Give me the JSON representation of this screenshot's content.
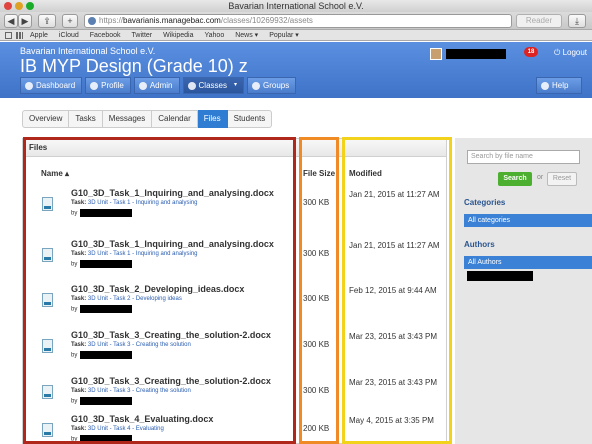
{
  "browser": {
    "window_title": "Bavarian International School e.V.",
    "url_scheme": "https://",
    "url_host": "bavarianis.managebac.com",
    "url_path": "/classes/10269932/assets",
    "reader_label": "Reader",
    "add_tab": "+",
    "bookmarks": [
      "Apple",
      "iCloud",
      "Facebook",
      "Twitter",
      "Wikipedia",
      "Yahoo",
      "News ▾",
      "Popular ▾"
    ]
  },
  "header": {
    "school": "Bavarian International School e.V.",
    "class_title": "IB MYP Design (Grade 10) z",
    "notifications": "18",
    "logout": "Logout"
  },
  "nav": {
    "items": [
      "Dashboard",
      "Profile",
      "Admin",
      "Classes",
      "Groups"
    ],
    "help": "Help"
  },
  "tabs": [
    "Overview",
    "Tasks",
    "Messages",
    "Calendar",
    "Files",
    "Students"
  ],
  "active_tab": "Files",
  "files": {
    "section_title": "Files",
    "col_name": "Name ▴",
    "col_size": "File Size",
    "col_modified": "Modified",
    "task_label": "Task:",
    "by_label": "by",
    "rows": [
      {
        "name": "G10_3D_Task_1_Inquiring_and_analysing.docx",
        "task": "3D Unit - Task 1 - Inquiring and analysing",
        "size": "300 KB",
        "modified": "Jan 21, 2015 at 11:27 AM"
      },
      {
        "name": "G10_3D_Task_1_Inquiring_and_analysing.docx",
        "task": "3D Unit - Task 1 - Inquiring and analysing",
        "size": "300 KB",
        "modified": "Jan 21, 2015 at 11:27 AM"
      },
      {
        "name": "G10_3D_Task_2_Developing_ideas.docx",
        "task": "3D Unit - Task 2 - Developing ideas",
        "size": "300 KB",
        "modified": "Feb 12, 2015 at 9:44 AM"
      },
      {
        "name": "G10_3D_Task_3_Creating_the_solution-2.docx",
        "task": "3D Unit - Task 3 - Creating the solution",
        "size": "300 KB",
        "modified": "Mar 23, 2015 at 3:43 PM"
      },
      {
        "name": "G10_3D_Task_3_Creating_the_solution-2.docx",
        "task": "3D Unit - Task 3 - Creating the solution",
        "size": "300 KB",
        "modified": "Mar 23, 2015 at 3:43 PM"
      },
      {
        "name": "G10_3D_Task_4_Evaluating.docx",
        "task": "3D Unit - Task 4 - Evaluating",
        "size": "200 KB",
        "modified": "May 4, 2015 at 3:35 PM"
      }
    ]
  },
  "sidebar": {
    "search_placeholder": "Search by file name",
    "search_button": "Search",
    "or_label": "or",
    "reset_button": "Reset",
    "categories_title": "Categories",
    "categories_selected": "All categories",
    "authors_title": "Authors",
    "authors_selected": "All Authors"
  },
  "colors": {
    "header_blue": "#4a7fd4",
    "active_tab": "#2f7dd3",
    "search_green": "#4caf2f",
    "highlight_red": "#b0281c",
    "highlight_orange": "#f08a24",
    "highlight_yellow": "#f2d21b"
  }
}
